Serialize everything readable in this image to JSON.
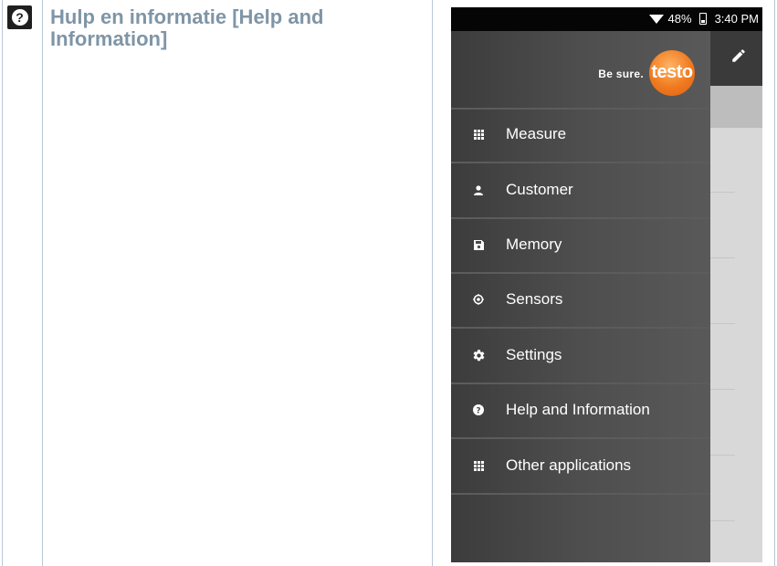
{
  "doc": {
    "heading": "Hulp en informatie [Help and Information]"
  },
  "phone": {
    "status": {
      "battery": "48%",
      "time": "3:40 PM"
    },
    "drawer": {
      "tagline": "Be sure.",
      "logo_text": "testo",
      "items": [
        {
          "label": "Measure",
          "icon": "grid-icon"
        },
        {
          "label": "Customer",
          "icon": "person-icon"
        },
        {
          "label": "Memory",
          "icon": "save-icon"
        },
        {
          "label": "Sensors",
          "icon": "sensor-icon"
        },
        {
          "label": "Settings",
          "icon": "gear-icon"
        },
        {
          "label": "Help and Information",
          "icon": "help-icon"
        },
        {
          "label": "Other applications",
          "icon": "grid-icon"
        }
      ]
    }
  },
  "colors": {
    "accent": "#f07a1e",
    "heading": "#7f95a6",
    "drawer": "#4e4e4e"
  }
}
